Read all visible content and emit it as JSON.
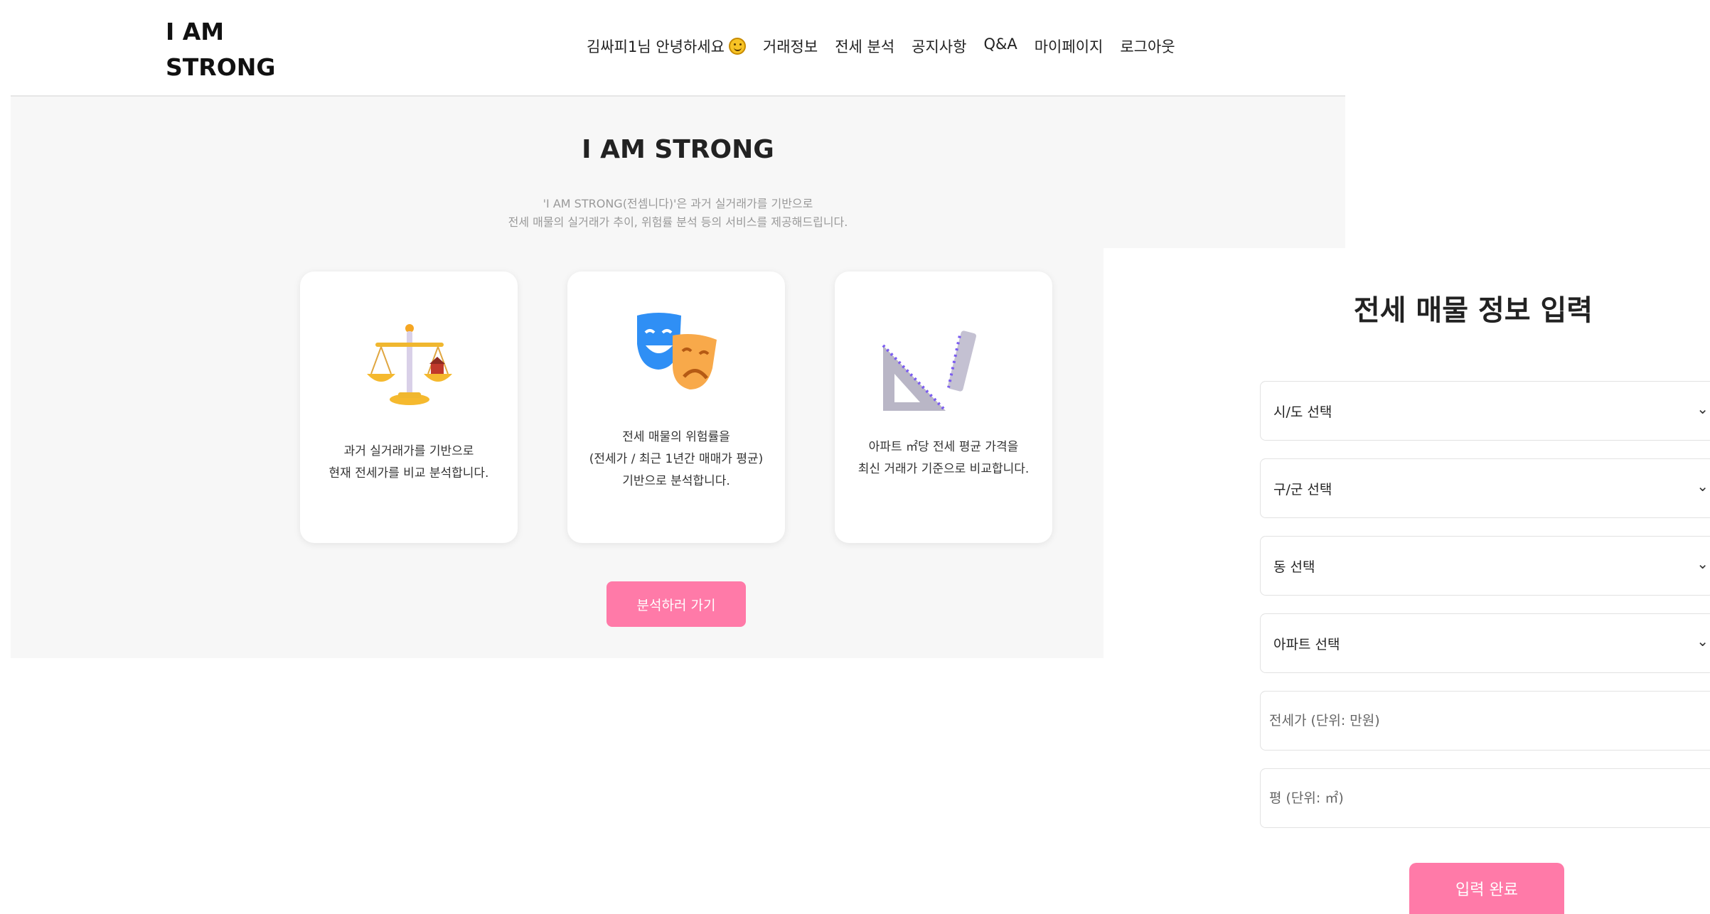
{
  "header": {
    "logo": "I AM\nSTRONG",
    "greeting": "김싸피1님 안녕하세요",
    "nav": [
      "거래정보",
      "전세 분석",
      "공지사항",
      "Q&A",
      "마이페이지",
      "로그아웃"
    ]
  },
  "hero": {
    "title": "I AM STRONG",
    "desc_line1": "'I AM STRONG(전셈니다)'은 과거 실거래가를 기반으로",
    "desc_line2": "전세 매물의 실거래가 추이, 위험률 분석 등의 서비스를 제공해드립니다."
  },
  "cards": [
    {
      "icon": "scales-icon",
      "text": "과거 실거래가를 기반으로\n현재 전세가를 비교 분석합니다."
    },
    {
      "icon": "theater-masks-icon",
      "text": "전세 매물의 위험률을\n(전세가 / 최근 1년간 매매가 평균)\n기반으로 분석합니다."
    },
    {
      "icon": "triangle-ruler-icon",
      "text": "아파트 ㎡당 전세 평균 가격을\n최신 거래가 기준으로 비교합니다."
    }
  ],
  "analyze_button": "분석하러 가기",
  "form": {
    "title": "전세 매물 정보 입력",
    "selects": [
      "시/도 선택",
      "구/군 선택",
      "동 선택",
      "아파트 선택"
    ],
    "price_placeholder": "전세가 (단위: 만원)",
    "area_placeholder": "평 (단위: ㎡)",
    "submit": "입력 완료"
  },
  "colors": {
    "accent": "#ff7aa8",
    "hero_bg": "#f7f7f7"
  }
}
